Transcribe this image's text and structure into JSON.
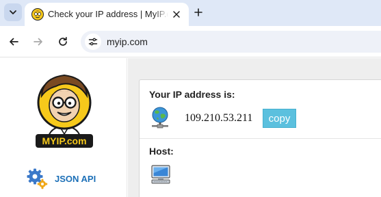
{
  "browser": {
    "tab": {
      "title": "Check your IP address | MyIP.com",
      "favicon": "myip-face-favicon-icon"
    },
    "new_tab_icon": "plus-icon",
    "toolbar": {
      "back_icon": "arrow-left-icon",
      "forward_icon": "arrow-right-icon",
      "reload_icon": "reload-icon",
      "site_info_icon": "tune-icon",
      "url": "myip.com"
    }
  },
  "sidebar": {
    "logo_text": "MYIP.com",
    "json_api": {
      "label": "JSON API",
      "icon": "gears-icon"
    }
  },
  "main": {
    "ip_section": {
      "heading": "Your IP address is:",
      "ip": "109.210.53.211",
      "copy_label": "copy",
      "icon": "globe-network-icon"
    },
    "host_section": {
      "heading": "Host:",
      "icon": "monitor-icon"
    }
  },
  "colors": {
    "tabstrip": "#dfe8f7",
    "omnibox": "#eef1f8",
    "copy_button": "#5bc0de",
    "link_blue": "#1b6fb7",
    "page_bg": "#eeeeee"
  }
}
